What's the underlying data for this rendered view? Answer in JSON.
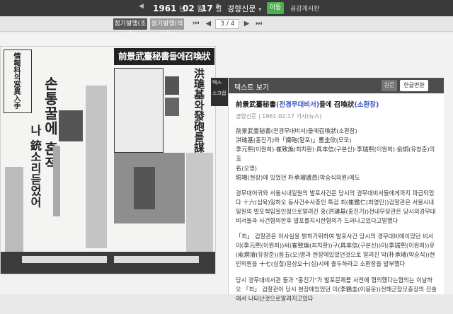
{
  "topbar": {
    "year": "1961",
    "month": "02",
    "day": "17",
    "year_unit": "년",
    "month_unit": "월",
    "day_unit": "일",
    "publisher": "경향신문",
    "move_button": "이동",
    "notice_link": "공감게시판"
  },
  "subbar": {
    "tab1": "정기발행(조간)",
    "tab2": "정기발행(석간)",
    "current_page": "3",
    "total_pages": "/ 4"
  },
  "strip": {
    "label1": "텍스",
    "label2": "스크랩"
  },
  "panel": {
    "header_title": "텍스트 보기",
    "btn_original": "원문",
    "btn_convert": "한글변환",
    "article_title_a": "前景武臺秘書",
    "article_title_b": "(전경무대비서)",
    "article_title_c": "들에 召喚狀",
    "article_title_d": "(소환장)",
    "article_meta": "경향신문 | 1961.02.17 기사(뉴스)",
    "p1_l1": "前景武臺秘書(전경무대비서)들에召喚狀(소환장)",
    "p1_l2": "洪璡基(홍진기)와「鐵砲(말포)」曹圭欣(모모)",
    "p1_l3": "李元熙(이원희)·崔致煥(최치환)·具本信(구본신)·李瑞熙(이원희)·俞炯(유창준)의五",
    "p1_l4": "名(오명)",
    "p1_l5": "現場(현장)에 있었던 朴承璿議員(박승식의원)에도",
    "p2": "경무대어귀와 서울시내일원의 발포사건은 당시의 경무대비서들에게까지 파급되었다 十六(십육)일하오 동사건수사중인 특검 최(崔鑑仁(최영민))검찰관은 서울시내일원의 발포책임을인정으로알려진 홍(洪璡基(홍진기))전내무장관은 당시의경무대비서들과 사건혐의한후 발포를지시한혐의가 드러나고있다고말했다",
    "p3": "「최」 검찰관은 이사실을 밝히기위하여 발포사건 당시의 경무대비에이었던 비서 이(李元熙(이원희))씨(崔致煥(최치환))구(具本信(구본신))이(李瑞熙(이원희))유(兪炯濬(유창준))등五(오)명과 현장에있었던것으로 알려진 박(朴承璿(박승식))현민의원을 十七(십칠)일상오十(십)시에 출두하라고 소환장을 발부했다",
    "p4": "당시 경무대비서관 들과 \"홍진기\"가 발포문제를 사전에 협의했다는혐의는 이날하오 「최」 검찰관이 당시 현장에있었던 이(李鶴圭(이용운))전해군참모총장의 진술에서 나타난것으로알려지고있다"
  },
  "newspaper": {
    "h1": "前景武臺秘書들에召喚狀",
    "h2": "洪璡基와發砲를謀議",
    "h3": "손통꿀에 혼적",
    "h4": "나 銃소리듣었어",
    "h5": "情報科의窓異入手"
  }
}
